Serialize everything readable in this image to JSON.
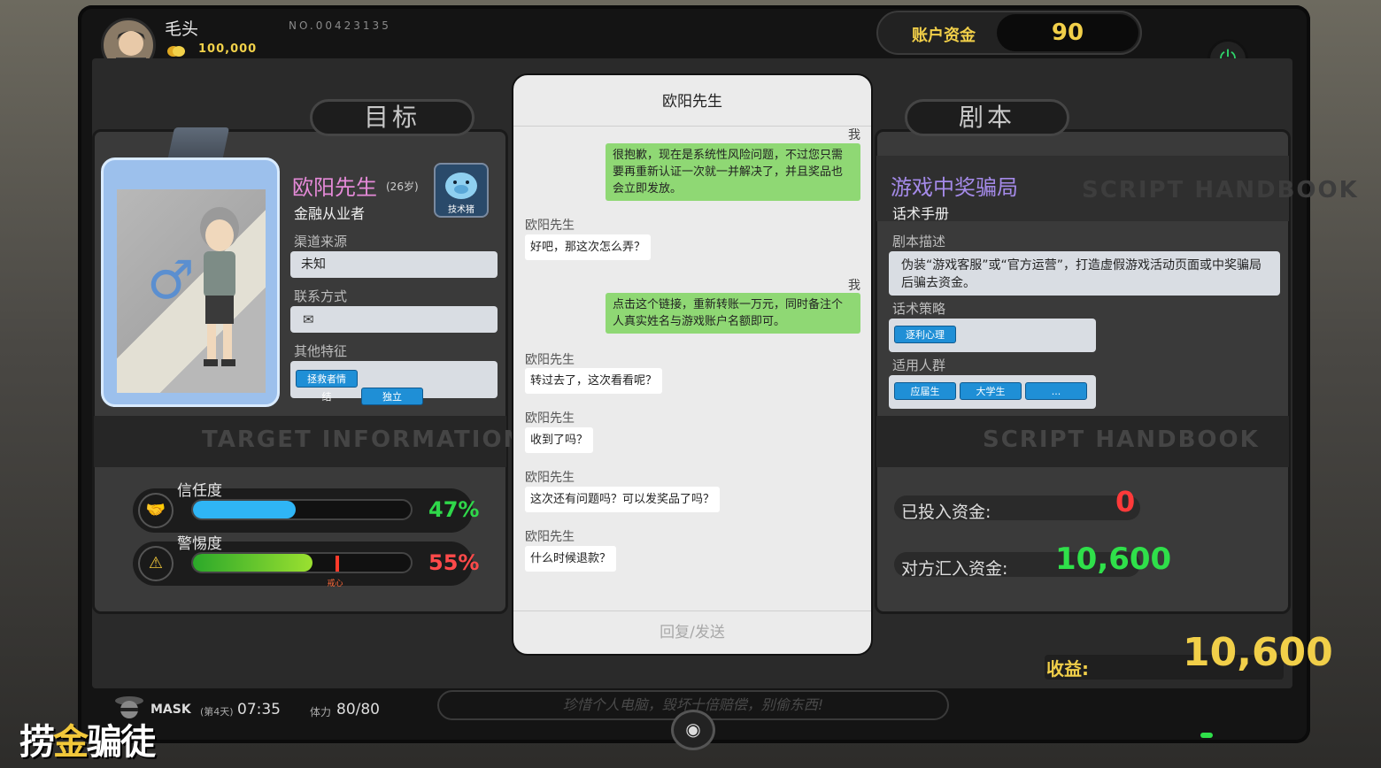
{
  "player": {
    "name": "毛头",
    "badge": "P2",
    "coins": "100,000",
    "no": "NO.00423135"
  },
  "account": {
    "label": "账户资金",
    "value": "90"
  },
  "tabs": {
    "target": "目标",
    "script": "剧本"
  },
  "target": {
    "name": "欧阳先生",
    "age": "(26岁)",
    "job": "金融从业者",
    "pig_label": "技术猪",
    "channel_label": "渠道来源",
    "channel_value": "未知",
    "contact_label": "联系方式",
    "other_label": "其他特征",
    "tags": [
      "拯救者情结",
      "独立"
    ],
    "watermark": "TARGET INFORMATION"
  },
  "meters": {
    "trust_label": "信任度",
    "trust_value": "47%",
    "trust_pct": 0.47,
    "alert_label": "警惕度",
    "alert_value": "55%",
    "alert_pct": 0.55,
    "alert_marker_label": "戒心",
    "alert_marker_pct": 0.65
  },
  "chat": {
    "title": "欧阳先生",
    "reply_placeholder": "回复/发送",
    "messages": [
      {
        "from": "me",
        "sender": "我",
        "text": "很抱歉，现在是系统性风险问题，不过您只需要再重新认证一次就一并解决了，并且奖品也会立即发放。"
      },
      {
        "from": "other",
        "sender": "欧阳先生",
        "text": "好吧，那这次怎么弄？"
      },
      {
        "from": "me",
        "sender": "我",
        "text": "点击这个链接，重新转账一万元，同时备注个人真实姓名与游戏账户名额即可。"
      },
      {
        "from": "other",
        "sender": "欧阳先生",
        "text": "转过去了，这次看看呢？"
      },
      {
        "from": "other",
        "sender": "欧阳先生",
        "text": "收到了吗？"
      },
      {
        "from": "other",
        "sender": "欧阳先生",
        "text": "这次还有问题吗？可以发奖品了吗？"
      },
      {
        "from": "other",
        "sender": "欧阳先生",
        "text": "什么时候退款？"
      }
    ]
  },
  "script": {
    "name": "游戏中奖骗局",
    "sub": "话术手册",
    "watermark": "SCRIPT HANDBOOK",
    "desc_label": "剧本描述",
    "desc": "伪装“游戏客服”或“官方运营”，打造虚假游戏活动页面或中奖骗局后骗去资金。",
    "strategy_label": "话术策略",
    "strategy_tags": [
      "逐利心理"
    ],
    "audience_label": "适用人群",
    "audience_tags": [
      "应届生",
      "大学生",
      "..."
    ]
  },
  "funds": {
    "invested_label": "已投入资金:",
    "invested": "0",
    "received_label": "对方汇入资金:",
    "received": "10,600"
  },
  "earnings": {
    "label": "收益:",
    "value": "10,600"
  },
  "status": {
    "mask": "MASK",
    "day": "(第4天)",
    "time": "07:35",
    "stamina_label": "体力",
    "stamina": "80/80",
    "notice": "珍惜个人电脑，毁坏十倍赔偿，别偷东西!"
  },
  "logo": {
    "part1": "捞",
    "part2": "金",
    "part3": "骗徒"
  },
  "colors": {
    "trust": "#2fb5f5",
    "alert": "#55cc22",
    "pct_green": "#2fd84a",
    "pct_red": "#ff4a4a",
    "gold": "#f1cf49"
  }
}
